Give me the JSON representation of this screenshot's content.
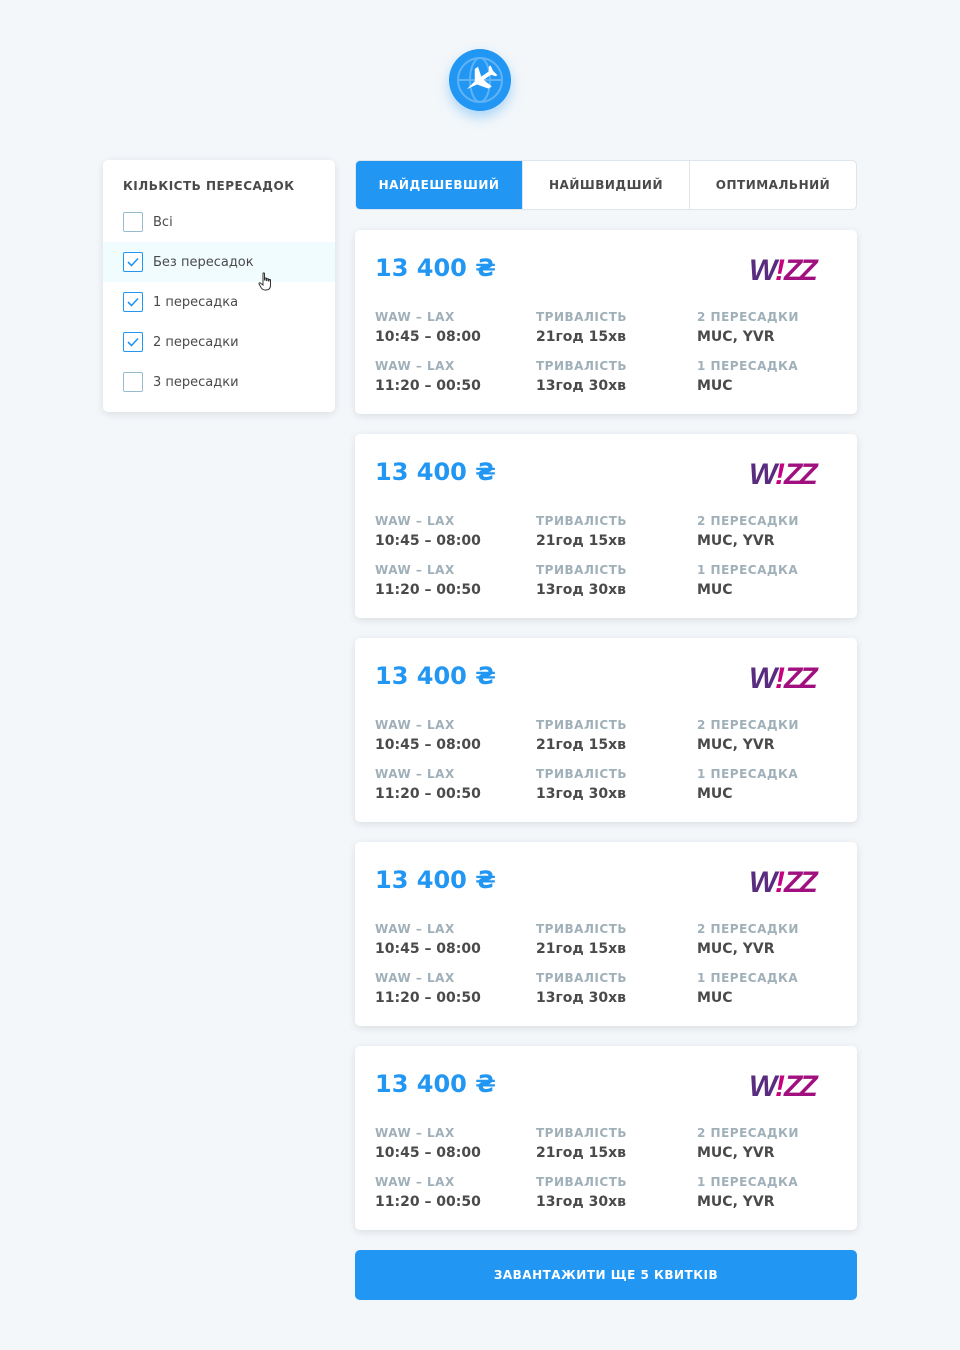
{
  "logo": {
    "icon": "airplane-globe-icon",
    "color": "#2196f3"
  },
  "filter": {
    "title": "Кількість пересадок",
    "options": [
      {
        "label": "Всі",
        "checked": false
      },
      {
        "label": "Без пересадок",
        "checked": true
      },
      {
        "label": "1 пересадка",
        "checked": true
      },
      {
        "label": "2 пересадки",
        "checked": true
      },
      {
        "label": "3 пересадки",
        "checked": false
      }
    ]
  },
  "tabs": [
    {
      "label": "НАЙДЕШЕВШИЙ",
      "active": true
    },
    {
      "label": "НАЙШВИДШИЙ",
      "active": false
    },
    {
      "label": "ОПТИМАЛЬНИЙ",
      "active": false
    }
  ],
  "tickets": [
    {
      "price": "13 400 ₴",
      "carrier": "WIZZ",
      "segments": [
        {
          "route": "WAW – LAX",
          "time": "10:45 – 08:00",
          "duration_label": "Тривалість",
          "duration": "21год 15хв",
          "stops_label": "2 пересадки",
          "stops": "MUC, YVR"
        },
        {
          "route": "WAW – LAX",
          "time": "11:20 – 00:50",
          "duration_label": "Тривалість",
          "duration": "13год 30хв",
          "stops_label": "1 пересадка",
          "stops": "MUC"
        }
      ]
    },
    {
      "price": "13 400 ₴",
      "carrier": "WIZZ",
      "segments": [
        {
          "route": "WAW – LAX",
          "time": "10:45 – 08:00",
          "duration_label": "Тривалість",
          "duration": "21год 15хв",
          "stops_label": "2 пересадки",
          "stops": "MUC, YVR"
        },
        {
          "route": "WAW – LAX",
          "time": "11:20 – 00:50",
          "duration_label": "Тривалість",
          "duration": "13год 30хв",
          "stops_label": "1 пересадка",
          "stops": "MUC"
        }
      ]
    },
    {
      "price": "13 400 ₴",
      "carrier": "WIZZ",
      "segments": [
        {
          "route": "WAW – LAX",
          "time": "10:45 – 08:00",
          "duration_label": "Тривалість",
          "duration": "21год 15хв",
          "stops_label": "2 пересадки",
          "stops": "MUC, YVR"
        },
        {
          "route": "WAW – LAX",
          "time": "11:20 – 00:50",
          "duration_label": "Тривалість",
          "duration": "13год 30хв",
          "stops_label": "1 пересадка",
          "stops": "MUC"
        }
      ]
    },
    {
      "price": "13 400 ₴",
      "carrier": "WIZZ",
      "segments": [
        {
          "route": "WAW – LAX",
          "time": "10:45 – 08:00",
          "duration_label": "Тривалість",
          "duration": "21год 15хв",
          "stops_label": "2 пересадки",
          "stops": "MUC, YVR"
        },
        {
          "route": "WAW – LAX",
          "time": "11:20 – 00:50",
          "duration_label": "Тривалість",
          "duration": "13год 30хв",
          "stops_label": "1 пересадка",
          "stops": "MUC"
        }
      ]
    },
    {
      "price": "13 400 ₴",
      "carrier": "WIZZ",
      "segments": [
        {
          "route": "WAW – LAX",
          "time": "10:45 – 08:00",
          "duration_label": "Тривалість",
          "duration": "21год 15хв",
          "stops_label": "2 пересадки",
          "stops": "MUC, YVR"
        },
        {
          "route": "WAW – LAX",
          "time": "11:20 – 00:50",
          "duration_label": "Тривалість",
          "duration": "13год 30хв",
          "stops_label": "1 пересадка",
          "stops": "MUC, YVR"
        }
      ]
    }
  ],
  "load_more": "ЗАВАНТАЖИТИ ЩЕ 5 КВИТКІВ",
  "colors": {
    "accent": "#2196f3",
    "wizz_magenta": "#c6007e",
    "wizz_purple": "#5a2c80"
  }
}
